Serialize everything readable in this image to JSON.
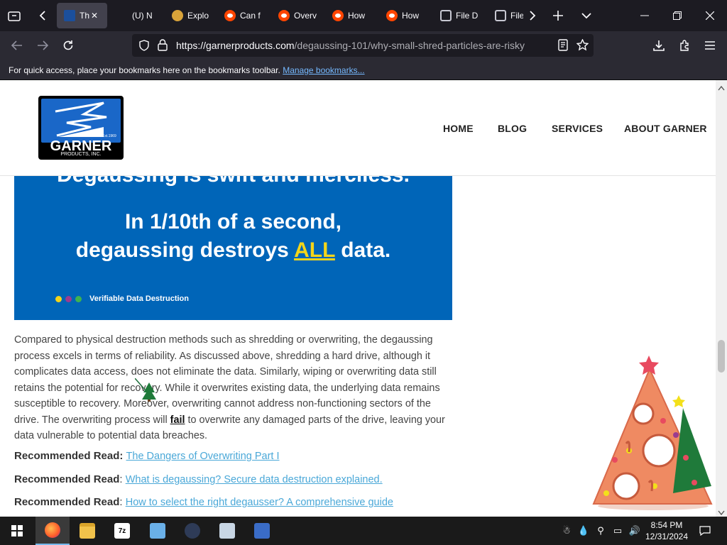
{
  "browser": {
    "tabs": [
      {
        "label": "Th",
        "favicon": "garner-favicon",
        "active": true
      },
      {
        "label": "(U) N",
        "favicon": "blank-favicon"
      },
      {
        "label": "Explo",
        "favicon": "chrome-favicon"
      },
      {
        "label": "Can f",
        "favicon": "reddit-favicon"
      },
      {
        "label": "Overv",
        "favicon": "reddit-favicon"
      },
      {
        "label": "How",
        "favicon": "reddit-favicon"
      },
      {
        "label": "How",
        "favicon": "reddit-favicon"
      },
      {
        "label": "File D",
        "favicon": "file-favicon"
      },
      {
        "label": "File",
        "favicon": "file-favicon"
      }
    ],
    "url": {
      "host": "https://garnerproducts.com",
      "path": "/degaussing-101/why-small-shred-particles-are-risky"
    },
    "bookmarks_message": "For quick access, place your bookmarks here on the bookmarks toolbar.",
    "bookmarks_link": "Manage bookmarks..."
  },
  "site": {
    "logo": {
      "word": "GARNER",
      "sub": "PRODUCTS, INC.",
      "est": "Est.1969"
    },
    "menu": [
      "HOME",
      "BLOG",
      "SERVICES",
      "ABOUT GARNER"
    ]
  },
  "banner": {
    "line0": "Degaussing is swift and merciless.",
    "line1": "In 1/10th of a second,",
    "line2_pre": "degaussing destroys ",
    "line2_em": "ALL",
    "line2_post": " data.",
    "dots_label": "Verifiable Data Destruction",
    "dot_colors": [
      "#f3d51a",
      "#9b3b8f",
      "#3fb34f"
    ]
  },
  "article": {
    "p1_a": "Compared to physical destruction methods such as shredding or overwriting, the degaussing process excels in terms of reliability. As discussed above, shredding a hard drive, although it complicates data access, does not eliminate the data. Similarly, wiping or overwriting data still retains the potential for recovery. While it overwrites existing data, the underlying data remains susceptible to recovery. Moreover, overwriting cannot address non-functioning sectors of the drive. The overwriting process will ",
    "p1_fail": "fail",
    "p1_b": " to overwrite any damaged parts of the drive, leaving your data vulnerable to potential data breaches.",
    "recommended": [
      {
        "label": "Recommended Read:",
        "link": "The Dangers of Overwriting Part I"
      },
      {
        "label": "Recommended Read",
        "link": "What is degaussing? Secure data destruction explained."
      },
      {
        "label": "Recommended Read",
        "link": "How to select the right degausser? A comprehensive guide"
      }
    ]
  },
  "taskbar": {
    "clock_time": "8:54 PM",
    "clock_date": "12/31/2024",
    "apps": [
      "firefox-icon",
      "file-explorer-icon",
      "7zip-icon",
      "settings-icon",
      "user-tool-icon",
      "media-icon",
      "network-tool-icon"
    ]
  },
  "colors": {
    "banner_bg": "#0065b8",
    "banner_highlight": "#f3d51a",
    "link": "#4aa8d8",
    "browser_dark": "#1c1b22"
  }
}
